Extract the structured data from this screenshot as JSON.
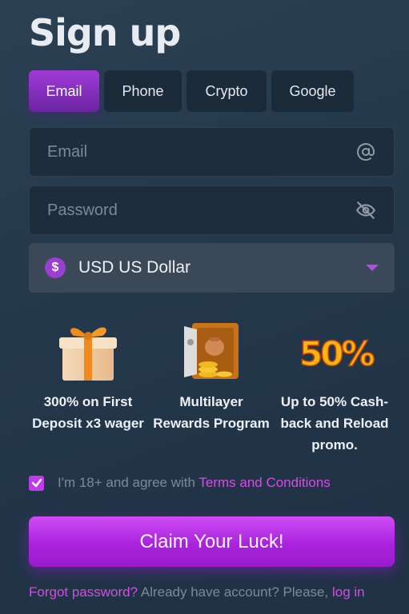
{
  "page": {
    "title": "Sign up"
  },
  "tabs": [
    {
      "label": "Email",
      "active": true
    },
    {
      "label": "Phone",
      "active": false
    },
    {
      "label": "Crypto",
      "active": false
    },
    {
      "label": "Google",
      "active": false
    }
  ],
  "form": {
    "email": {
      "placeholder": "Email",
      "value": "",
      "icon": "at-icon"
    },
    "password": {
      "placeholder": "Password",
      "value": "",
      "icon": "eye-off-icon"
    },
    "currency": {
      "symbol": "$",
      "label": "USD US Dollar",
      "icon": "dollar-coin-icon"
    }
  },
  "promos": [
    {
      "text": "300% on First Deposit x3 wager",
      "icon": "gift-box-icon"
    },
    {
      "text": "Multilayer Rewards Program",
      "icon": "safe-with-coins-icon"
    },
    {
      "text": "Up to 50% Cash-back and Reload promo.",
      "icon": "fifty-percent-icon",
      "badge": "50%"
    }
  ],
  "agreement": {
    "checked": true,
    "text": "I'm 18+ and agree with ",
    "link": "Terms and Conditions"
  },
  "cta": {
    "label": "Claim Your Luck!"
  },
  "footer": {
    "forgot": "Forgot password?",
    "account_text": " Already have account? Please, ",
    "login": "log in"
  },
  "colors": {
    "accent": "#c13af0",
    "link": "#d44de3",
    "background": "#26394c",
    "field": "#1e2d3b"
  }
}
